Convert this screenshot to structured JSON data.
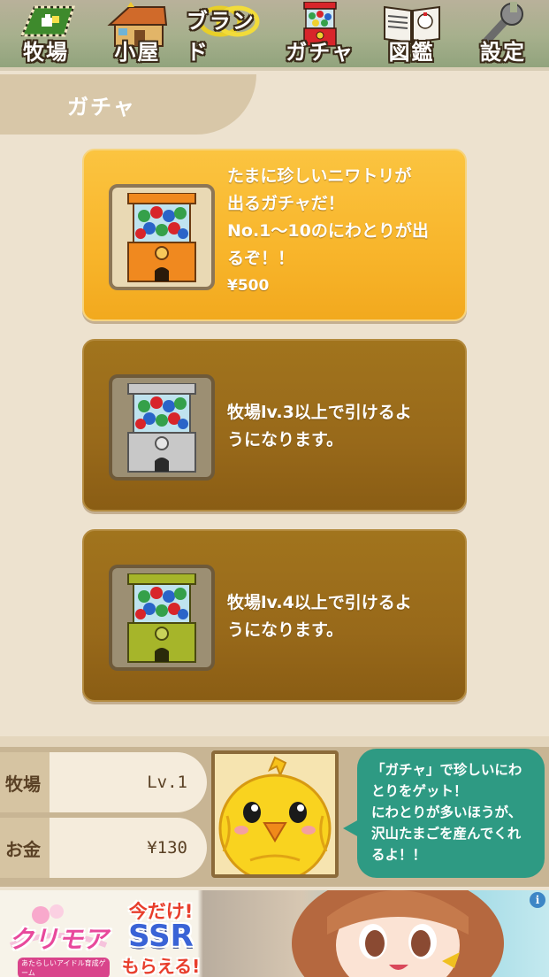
{
  "nav": {
    "items": [
      {
        "id": "ranch",
        "label": "牧場",
        "icon": "ranch-icon"
      },
      {
        "id": "hut",
        "label": "小屋",
        "icon": "hut-icon"
      },
      {
        "id": "brand",
        "label": "ブランド",
        "icon": "rings-icon"
      },
      {
        "id": "gacha",
        "label": "ガチャ",
        "icon": "gacha-machine-icon"
      },
      {
        "id": "encyclopedia",
        "label": "図鑑",
        "icon": "book-icon"
      },
      {
        "id": "settings",
        "label": "設定",
        "icon": "wrench-icon"
      }
    ]
  },
  "section_title": "ガチャ",
  "gacha": [
    {
      "state": "active",
      "machine_color": "#f0891f",
      "desc_lines": [
        "たまに珍しいニワトリが",
        "出るガチャだ！",
        "No.1〜10のにわとりが出",
        "るぞ！！"
      ],
      "price": "¥500"
    },
    {
      "state": "locked",
      "machine_color": "#bfbfbf",
      "desc_lines": [
        "牧場lv.3以上で引けるよ",
        "うになります。"
      ]
    },
    {
      "state": "locked",
      "machine_color": "#a6b52a",
      "desc_lines": [
        "牧場lv.4以上で引けるよ",
        "うになります。"
      ]
    }
  ],
  "status": {
    "ranch_label": "牧場",
    "ranch_level": "Lv.1",
    "money_label": "お金",
    "money_value": "¥130"
  },
  "speech_lines": [
    "「ガチャ」で珍しいにわ",
    "とりをゲット！",
    "にわとりが多いほうが、",
    "沢山たまごを産んでくれ",
    "るよ！！"
  ],
  "ad": {
    "logo": "クリモア",
    "logo_sub": "あたらしいアイドル育成ゲーム",
    "line1": "今だけ!",
    "line2": "SSR",
    "line3": "もらえる!",
    "info": "i"
  }
}
